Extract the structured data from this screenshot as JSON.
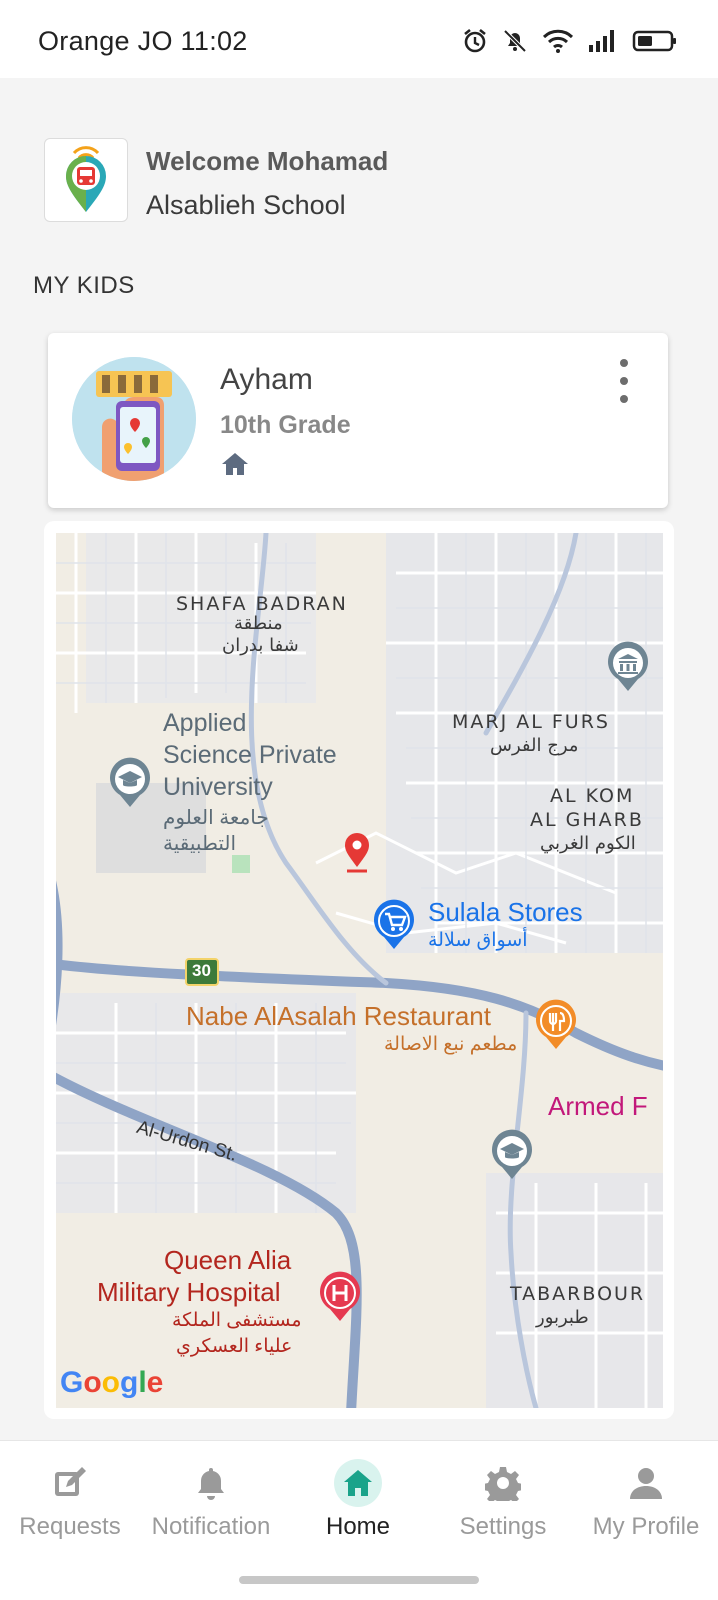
{
  "status_bar": {
    "carrier_time": "Orange JO 11:02",
    "icons": [
      "alarm-icon",
      "bell-muted-icon",
      "wifi-icon",
      "signal-icon",
      "battery-icon"
    ]
  },
  "header": {
    "welcome": "Welcome Mohamad",
    "school": "Alsablieh School"
  },
  "section_title": "MY KIDS",
  "kids": [
    {
      "name": "Ayham",
      "grade": "10th Grade",
      "status_icon": "home-icon"
    }
  ],
  "map": {
    "areas": {
      "shafa_en": "SHAFA BADRAN",
      "shafa_ar1": "منطقة",
      "shafa_ar2": "شفا بدران",
      "marj_en": "MARJ AL FURS",
      "marj_ar": "مرج الفرس",
      "kom_en1": "AL KOM",
      "kom_en2": "AL GHARB",
      "kom_ar": "الكوم الغربي",
      "tabar_en": "TABARBOUR",
      "tabar_ar": "طبربور"
    },
    "pois": {
      "uni_en1": "Applied",
      "uni_en2": "Science Private",
      "uni_en3": "University",
      "uni_ar1": "جامعة العلوم",
      "uni_ar2": "التطبيقية",
      "sulala_en": "Sulala Stores",
      "sulala_ar": "أسواق سلالة",
      "rest_en": "Nabe AlAsalah Restaurant",
      "rest_ar": "مطعم نبع الاصالة",
      "armed": "Armed F",
      "hosp_en1": "Queen Alia",
      "hosp_en2": "Military Hospital",
      "hosp_ar1": "مستشفى الملكة",
      "hosp_ar2": "علياء العسكري"
    },
    "road_name": "Al-Urdon St.",
    "route_number": "30",
    "google": [
      "G",
      "o",
      "o",
      "g",
      "l",
      "e"
    ],
    "colors": {
      "land": "#f1ede4",
      "road": "#8fa4c6",
      "street": "#ffffff",
      "pin": "#e53935"
    }
  },
  "nav": {
    "items": [
      {
        "label": "Requests",
        "icon": "edit-icon"
      },
      {
        "label": "Notification",
        "icon": "bell-icon"
      },
      {
        "label": "Home",
        "icon": "home-icon"
      },
      {
        "label": "Settings",
        "icon": "gear-icon"
      },
      {
        "label": "My Profile",
        "icon": "person-icon"
      }
    ],
    "active": "Home",
    "colors": {
      "active_bg": "#d9f3ee",
      "active_icon": "#1aa38a",
      "inactive": "#9a9a9a"
    }
  }
}
